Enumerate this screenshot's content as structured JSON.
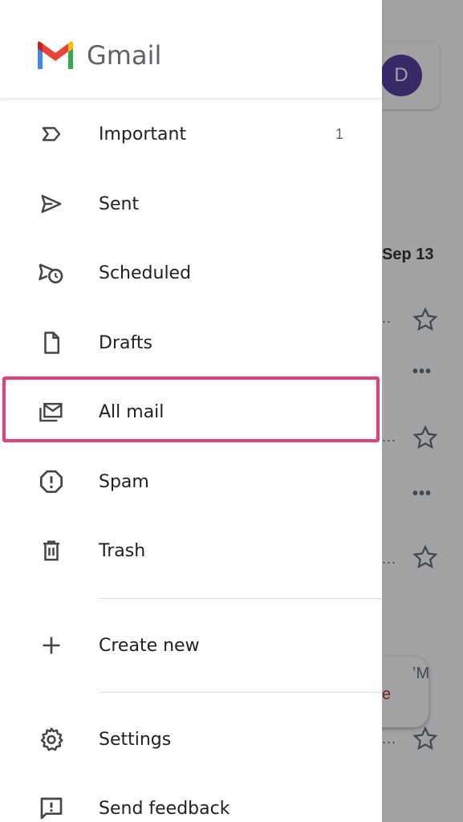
{
  "app": {
    "name": "Gmail"
  },
  "background": {
    "avatar_letter": "D",
    "date_label": "Sep 13",
    "truncated_1": "..",
    "truncated_2": "...",
    "truncated_3": "...",
    "truncated_4": "...",
    "fab_partial_text": "e",
    "time_partial": "’M"
  },
  "drawer": {
    "items": [
      {
        "label": "Important",
        "count": "1",
        "icon": "important-icon"
      },
      {
        "label": "Sent",
        "icon": "send-icon"
      },
      {
        "label": "Scheduled",
        "icon": "scheduled-icon"
      },
      {
        "label": "Drafts",
        "icon": "draft-icon"
      },
      {
        "label": "All mail",
        "icon": "all-mail-icon",
        "highlighted": true
      },
      {
        "label": "Spam",
        "icon": "spam-icon"
      },
      {
        "label": "Trash",
        "icon": "trash-icon"
      }
    ],
    "create_new": {
      "label": "Create new",
      "icon": "plus-icon"
    },
    "settings": {
      "label": "Settings",
      "icon": "gear-icon"
    },
    "feedback": {
      "label": "Send feedback",
      "icon": "feedback-icon"
    }
  },
  "colors": {
    "highlight": "#ea3b7b",
    "avatar": "#4a2f9c"
  }
}
